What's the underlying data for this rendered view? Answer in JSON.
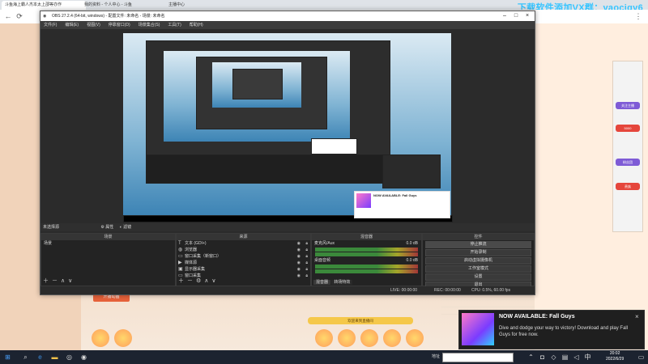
{
  "browser": {
    "tabs": [
      {
        "label": "斗鱼海上霸人杰本太上邵等亦作"
      },
      {
        "label": "OBS 27.2.4 (64-bit, windows) - 配置文件: 未命名 - 场景: 未命名"
      },
      {
        "label": "我的资料 - 个人中心 - 斗鱼"
      },
      {
        "label": "主播中心"
      }
    ],
    "watermark": "下载软件添加VX群：yaocigy6"
  },
  "obs": {
    "title": "OBS 27.2.4 (64-bit, windows) - 配置文件: 未命名 - 场景: 未命名",
    "menu": [
      "文件(F)",
      "编辑(E)",
      "视图(V)",
      "停靠窗口(D)",
      "场景集合(S)",
      "工具(T)",
      "帮助(H)"
    ],
    "source_bar": {
      "label": "未选择源",
      "props_label": "属性",
      "filters_label": "滤镜"
    },
    "docks": {
      "scenes": {
        "title": "场景",
        "items": [
          "场景"
        ]
      },
      "sources": {
        "title": "来源",
        "items": [
          {
            "label": "文本 (GDI+)",
            "icon": "text-icon"
          },
          {
            "label": "浏览器",
            "icon": "globe-icon"
          },
          {
            "label": "窗口采集（新窗口）",
            "icon": "window-icon"
          },
          {
            "label": "媒体源",
            "icon": "media-icon"
          },
          {
            "label": "显示器采集",
            "icon": "monitor-icon"
          },
          {
            "label": "窗口采集",
            "icon": "window-icon"
          }
        ]
      },
      "mixer": {
        "title": "混音器",
        "tracks": [
          {
            "name": "麦克风/Aux",
            "db": "0.0 dB"
          },
          {
            "name": "桌面音频",
            "db": "0.0 dB"
          }
        ],
        "tabs": [
          "混音器",
          "转场特效"
        ]
      },
      "controls": {
        "title": "控件",
        "buttons": [
          "停止推流",
          "开始录制",
          "启动虚拟摄像机",
          "工作室模式",
          "设置",
          "退出"
        ]
      }
    },
    "status": {
      "live": "LIVE: 00:00:00",
      "rec": "REC: 00:00:00",
      "cpu": "CPU: 0.5%, 60.00 fps"
    }
  },
  "web": {
    "orange_button": "开播动画",
    "gold_banner": "欢迎来到直播间",
    "side_badges": [
      "关注主播",
      "5000",
      "粉丝团",
      "贵族"
    ]
  },
  "notification": {
    "title": "NOW AVAILABLE: Fall Guys",
    "body": "Dive and dodge your way to victory! Download and play Fall Guys for free now."
  },
  "taskbar": {
    "search_label": "地址",
    "time": "20:02",
    "date": "2022/6/29"
  }
}
